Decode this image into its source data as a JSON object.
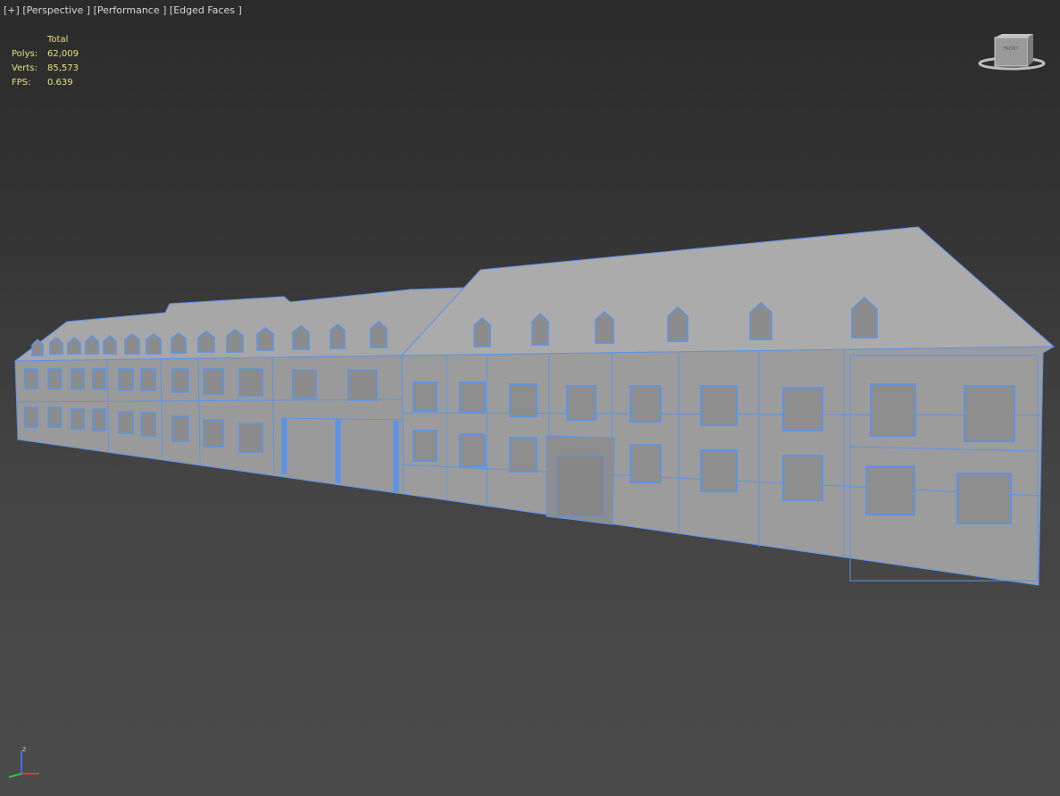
{
  "viewport": {
    "label_plus": "[+]",
    "label_view": "[Perspective ]",
    "label_shading": "[Performance ]",
    "label_edges": "[Edged Faces ]"
  },
  "stats": {
    "header": "Total",
    "polys_label": "Polys:",
    "polys_value": "62,009",
    "verts_label": "Verts:",
    "verts_value": "85,573",
    "fps_label": "FPS:",
    "fps_value": "0.639"
  },
  "viewcube": {
    "face_label": "FRONT"
  },
  "axis": {
    "z_label": "z"
  },
  "colors": {
    "background": "#3a3a3a",
    "wireframe": "#5b93e8",
    "model_surface": "#a4a4a4",
    "stats_text": "#e7e27a",
    "label_text": "#d6d6d6"
  }
}
